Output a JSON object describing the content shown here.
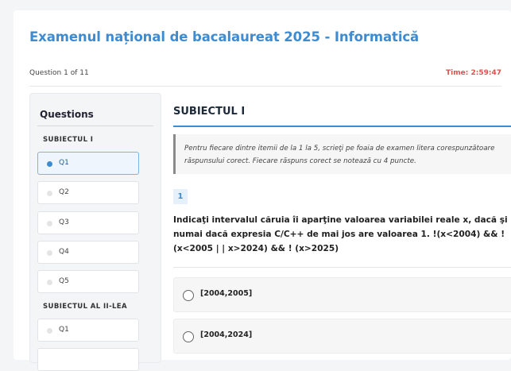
{
  "header": {
    "title": "Examenul național de bacalaureat 2025 - Informatică",
    "counter": "Question 1 of 11",
    "timer": "Time: 2:59:47"
  },
  "sidebar": {
    "title": "Questions",
    "sections": [
      {
        "label": "SUBIECTUL I",
        "items": [
          "Q1",
          "Q2",
          "Q3",
          "Q4",
          "Q5"
        ],
        "active": "Q1"
      },
      {
        "label": "SUBIECTUL AL II-LEA",
        "items": [
          "Q1"
        ]
      }
    ]
  },
  "main": {
    "section_title": "SUBIECTUL I",
    "instructions": "Pentru fiecare dintre itemii de la 1 la 5, scrieţi pe foaia de examen litera corespunzătoare răspunsului corect. Fiecare răspuns corect se notează cu 4 puncte.",
    "question_number": "1",
    "question_text": "Indicaţi intervalul căruia îi aparţine valoarea variabilei reale x, dacă şi numai dacă expresia C/C++ de mai jos are valoarea 1. !(x<2004) && !(x<2005 | | x>2024) && ! (x>2025)",
    "options": [
      "[2004,2005]",
      "[2004,2024]"
    ]
  },
  "colors": {
    "accent": "#3d8bd0",
    "timer": "#d9534f"
  }
}
